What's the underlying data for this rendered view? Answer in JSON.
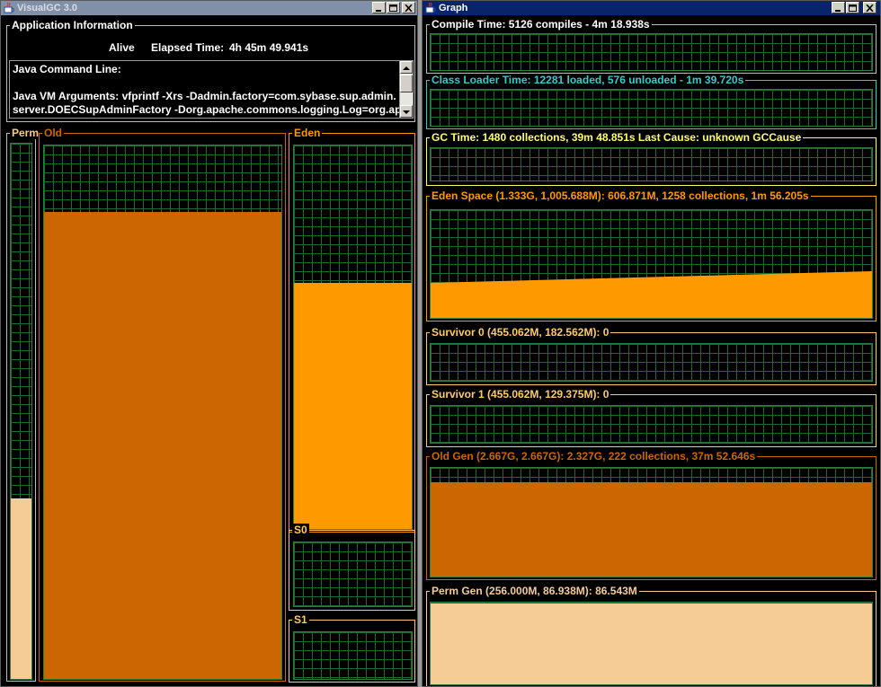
{
  "colors": {
    "perm": "#f5cc96",
    "old": "#cc6600",
    "eden": "#ff9900",
    "survivor": "#ffcc66",
    "gc": "#ffff66",
    "classloader": "#33cccc",
    "compile": "#ffffff",
    "grid": "#1c6b2f"
  },
  "left_window": {
    "title": "VisualGC 3.0",
    "app_info": {
      "title": "Application Information",
      "status": "Alive",
      "elapsed_label": "Elapsed Time:",
      "elapsed_value": "4h 45m 49.941s",
      "command_lines": [
        "Java Command Line:",
        "",
        "Java VM Arguments: vfprintf -Xrs -Dadmin.factory=com.sybase.sup.admin.",
        "server.DOECSupAdminFactory -Dorg.apache.commons.logging.Log=org.ap"
      ]
    },
    "spaces": {
      "perm": {
        "label": "Perm",
        "used_fraction": 0.338
      },
      "old": {
        "label": "Old",
        "used_fraction": 0.876
      },
      "eden": {
        "label": "Eden",
        "used_fraction": 0.642
      },
      "s0": {
        "label": "S0",
        "used_fraction": 0
      },
      "s1": {
        "label": "S1",
        "used_fraction": 0
      }
    }
  },
  "right_window": {
    "title": "Graph",
    "graphs": {
      "compile": {
        "label": "Compile Time: 5126 compiles - 4m 18.938s"
      },
      "classloader": {
        "label": "Class Loader Time: 12281 loaded, 576 unloaded - 1m 39.720s"
      },
      "gc": {
        "label": "GC Time: 1480 collections, 39m 48.851s  Last Cause: unknown GCCause"
      },
      "eden": {
        "label": "Eden Space (1.333G, 1,005.688M): 606.871M, 1258 collections, 1m 56.205s"
      },
      "s0": {
        "label": "Survivor 0 (455.062M, 182.562M): 0"
      },
      "s1": {
        "label": "Survivor 1 (455.062M, 129.375M): 0"
      },
      "old": {
        "label": "Old Gen (2.667G, 2.667G): 2.327G, 222 collections, 37m 52.646s",
        "used_fraction": 0.87
      },
      "perm": {
        "label": "Perm Gen (256.000M, 86.938M): 86.543M",
        "used_fraction": 0.99
      }
    }
  }
}
